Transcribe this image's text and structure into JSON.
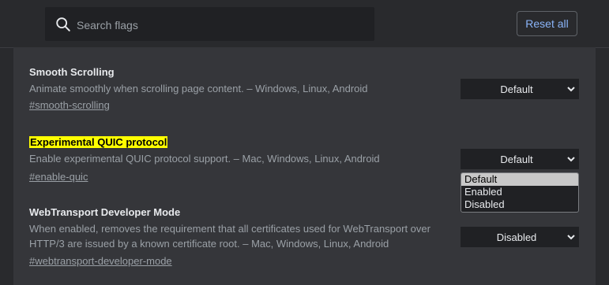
{
  "search": {
    "placeholder": "Search flags",
    "value": ""
  },
  "header": {
    "reset_label": "Reset all"
  },
  "colors": {
    "accent": "#8ab4f8",
    "highlight": "#ffff00",
    "panel": "#35363a",
    "background": "#292a2d"
  },
  "flags": [
    {
      "title": "Smooth Scrolling",
      "description": "Animate smoothly when scrolling page content. – Windows, Linux, Android",
      "link": "#smooth-scrolling",
      "value": "Default",
      "highlighted": false
    },
    {
      "title": "Experimental QUIC protocol",
      "description": "Enable experimental QUIC protocol support. – Mac, Windows, Linux, Android",
      "link": "#enable-quic",
      "value": "Default",
      "highlighted": true,
      "dropdown_open": true,
      "options": [
        "Default",
        "Enabled",
        "Disabled"
      ],
      "selected_option": "Default"
    },
    {
      "title": "WebTransport Developer Mode",
      "description_lines": [
        "When enabled, removes the requirement that all certificates used for WebTransport over",
        "HTTP/3 are issued by a known certificate root. – Mac, Windows, Linux, Android"
      ],
      "link": "#webtransport-developer-mode",
      "value": "Disabled",
      "highlighted": false
    }
  ]
}
